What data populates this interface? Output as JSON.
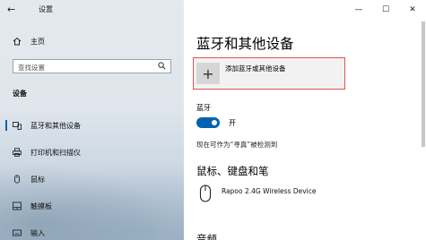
{
  "window": {
    "title": "设置",
    "controls": [
      "—",
      "☐",
      "✕"
    ]
  },
  "sidebar": {
    "home_label": "主页",
    "search_placeholder": "查找设置",
    "section_heading": "设备",
    "items": [
      {
        "label": "蓝牙和其他设备",
        "icon": "bluetooth-devices-icon",
        "active": true
      },
      {
        "label": "打印机和扫描仪",
        "icon": "printer-icon",
        "active": false
      },
      {
        "label": "鼠标",
        "icon": "mouse-icon",
        "active": false
      },
      {
        "label": "触摸板",
        "icon": "touchpad-icon",
        "active": false
      },
      {
        "label": "输入",
        "icon": "keyboard-icon",
        "active": false
      }
    ]
  },
  "main": {
    "page_title": "蓝牙和其他设备",
    "add_device_label": "添加蓝牙或其他设备",
    "bluetooth_label": "蓝牙",
    "toggle_state": "开",
    "discoverable_text": "现在可作为“寻真”被检测到",
    "section_mouse_keyboard": "鼠标、键盘和笔",
    "device_name": "Rapoo 2.4G Wireless Device",
    "section_audio": "音频"
  },
  "colors": {
    "accent": "#0063b1",
    "highlight_border": "#e05252"
  }
}
